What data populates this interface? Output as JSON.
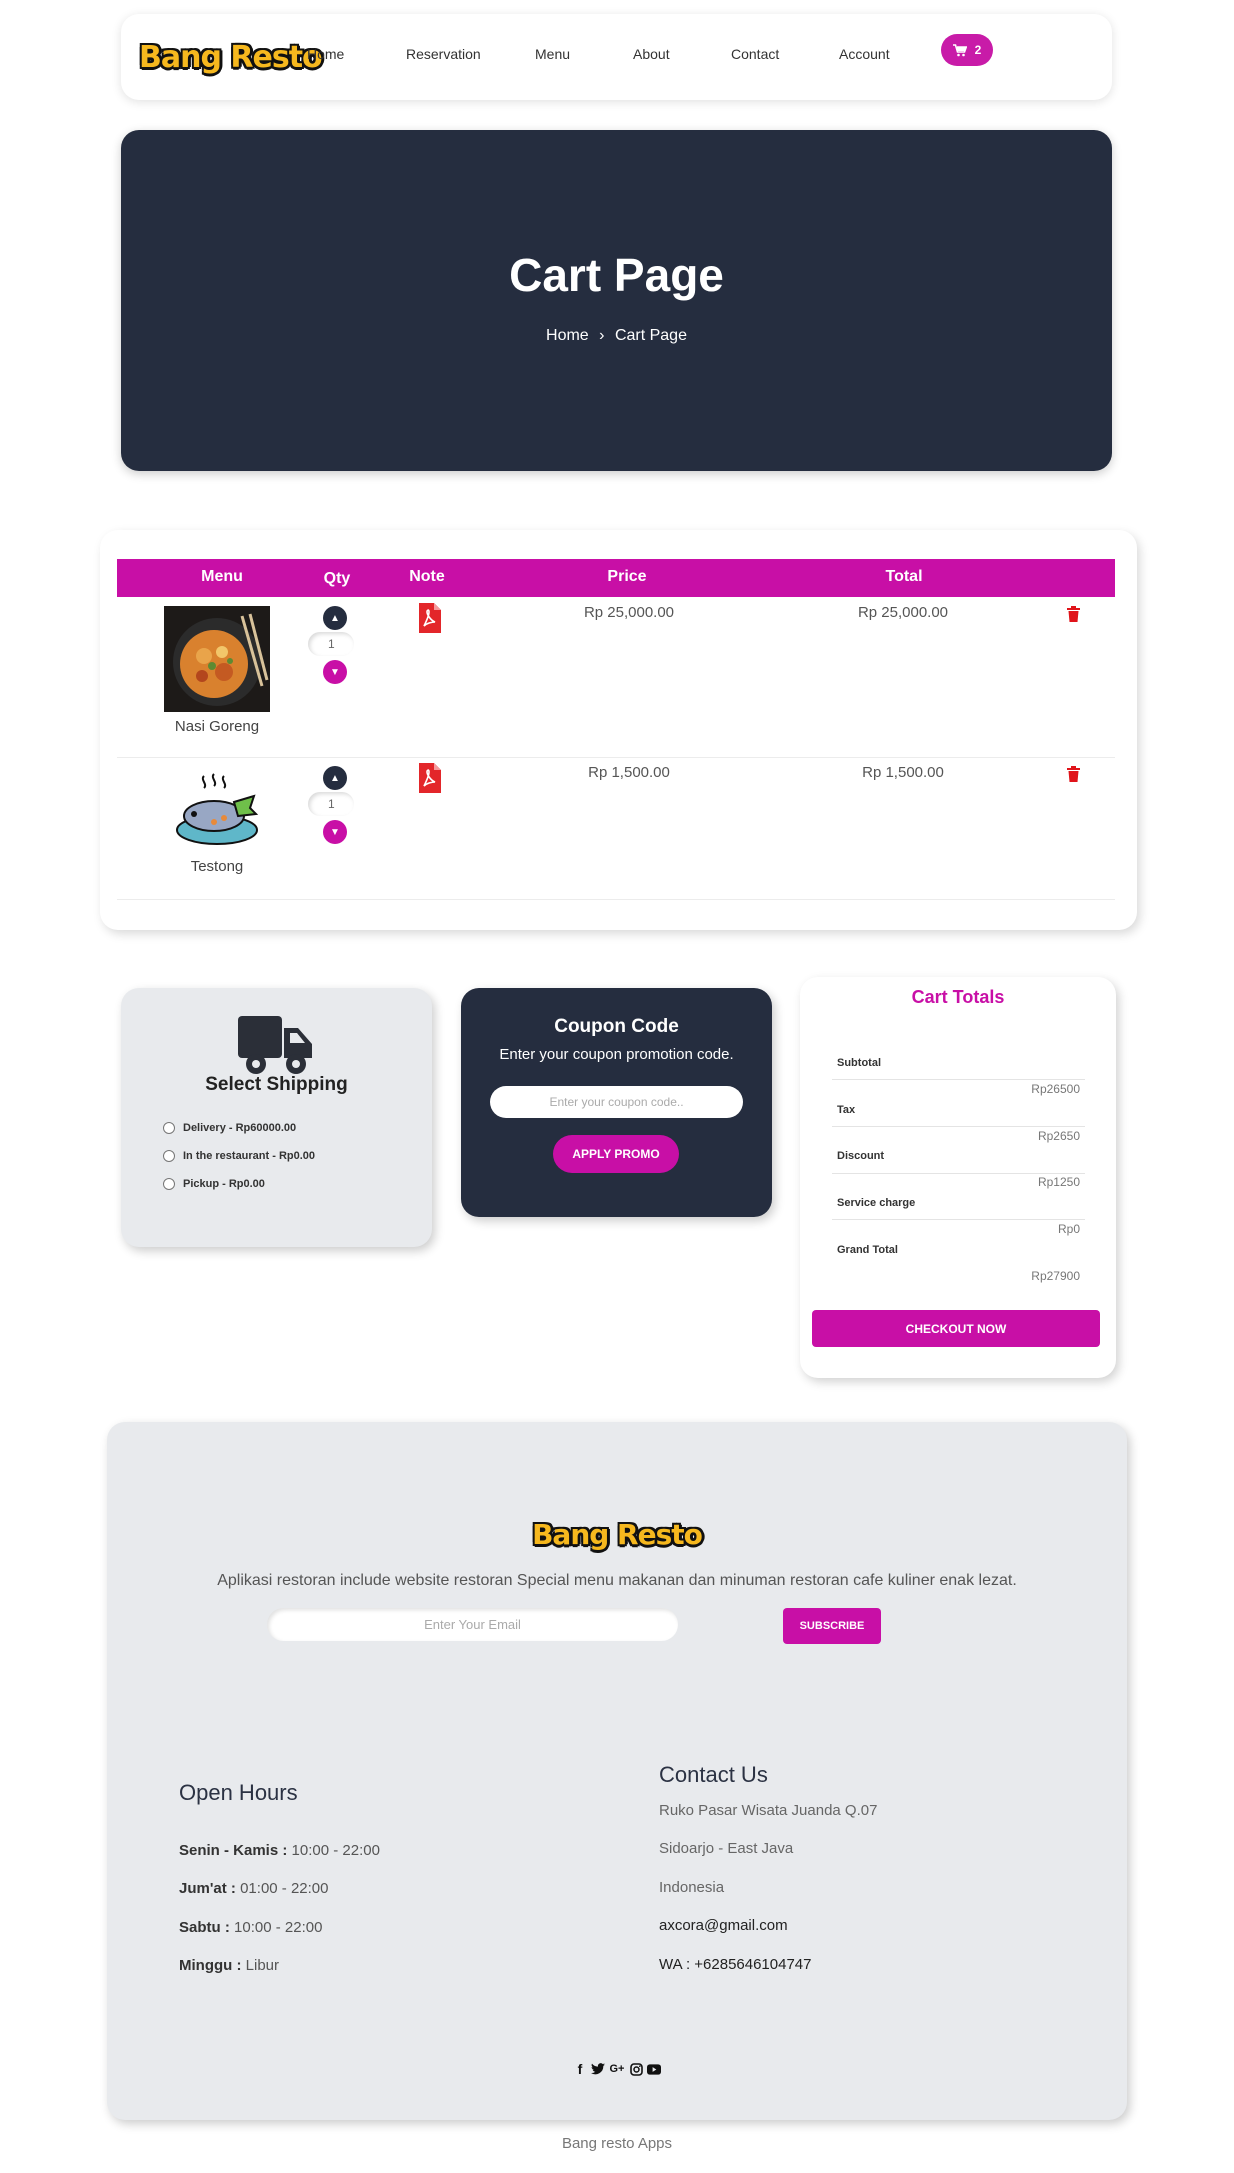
{
  "brand": {
    "name": "Bang Resto",
    "accent": "#c80fa6",
    "dark": "#252d3f"
  },
  "nav": {
    "items": [
      "Home",
      "Reservation",
      "Menu",
      "About",
      "Contact",
      "Account"
    ],
    "cart_count": "2"
  },
  "hero": {
    "title": "Cart Page",
    "breadcrumb_home": "Home",
    "breadcrumb_current": "Cart Page"
  },
  "cart": {
    "headers": [
      "Menu",
      "Qty",
      "Note",
      "Price",
      "Total"
    ],
    "items": [
      {
        "name": "Nasi Goreng",
        "qty": "1",
        "price": "Rp 25,000.00",
        "total": "Rp 25,000.00"
      },
      {
        "name": "Testong",
        "qty": "1",
        "price": "Rp 1,500.00",
        "total": "Rp 1,500.00"
      }
    ]
  },
  "shipping": {
    "title": "Select Shipping",
    "options": [
      "Delivery - Rp60000.00",
      "In the restaurant - Rp0.00",
      "Pickup - Rp0.00"
    ]
  },
  "coupon": {
    "title": "Coupon Code",
    "subtitle": "Enter your coupon promotion code.",
    "placeholder": "Enter your coupon code..",
    "button": "APPLY PROMO"
  },
  "totals": {
    "title": "Cart Totals",
    "rows": [
      {
        "label": "Subtotal",
        "value": "Rp26500"
      },
      {
        "label": "Tax",
        "value": "Rp2650"
      },
      {
        "label": "Discount",
        "value": "Rp1250"
      },
      {
        "label": "Service charge",
        "value": "Rp0"
      },
      {
        "label": "Grand Total",
        "value": "Rp27900"
      }
    ],
    "button": "CHECKOUT NOW"
  },
  "footer": {
    "logo": "Bang Resto",
    "description": "Aplikasi restoran include website restoran Special menu makanan dan minuman restoran cafe kuliner enak lezat.",
    "email_placeholder": "Enter Your Email",
    "subscribe": "SUBSCRIBE",
    "hours_title": "Open Hours",
    "hours": [
      {
        "day": "Senin - Kamis :",
        "time": " 10:00 - 22:00"
      },
      {
        "day": "Jum'at :",
        "time": " 01:00 - 22:00"
      },
      {
        "day": "Sabtu :",
        "time": " 10:00 - 22:00"
      },
      {
        "day": "Minggu :",
        "time": " Libur"
      }
    ],
    "contact_title": "Contact Us",
    "contact": {
      "address1": "Ruko Pasar Wisata Juanda Q.07",
      "address2": "Sidoarjo - East Java",
      "country": "Indonesia",
      "email": "axcora@gmail.com",
      "wa": "WA : +6285646104747"
    },
    "social_icons": [
      "facebook-icon",
      "twitter-icon",
      "google-plus-icon",
      "instagram-icon",
      "youtube-icon"
    ],
    "social_glyphs": [
      "f",
      "G+"
    ],
    "copyright": "Bang resto Apps"
  }
}
